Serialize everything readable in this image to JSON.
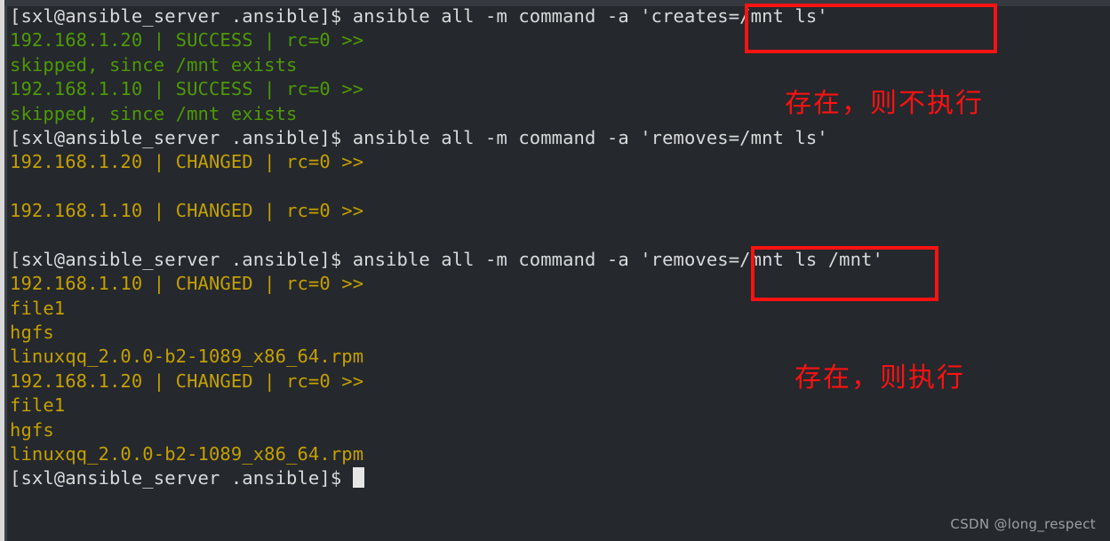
{
  "window": {
    "background_color": "#25282c",
    "top_strip_color": "#343a3f",
    "left_edge_color": "#d9d9d9"
  },
  "colors": {
    "prompt": "#d8dadb",
    "success": "#4e9a06",
    "changed": "#c4a000",
    "annotation_red": "#fb1212",
    "watermark": "#9aa0a6",
    "cursor": "#e6e6e6"
  },
  "terminal": {
    "prompt": "[sxl@ansible_server .ansible]$",
    "lines": [
      {
        "kind": "prompt",
        "prompt": "[sxl@ansible_server .ansible]$",
        "command": " ansible all -m command -a 'creates=/mnt ls'"
      },
      {
        "kind": "success",
        "text": "192.168.1.20 | SUCCESS | rc=0 >>"
      },
      {
        "kind": "success",
        "text": "skipped, since /mnt exists"
      },
      {
        "kind": "success",
        "text": "192.168.1.10 | SUCCESS | rc=0 >>"
      },
      {
        "kind": "success",
        "text": "skipped, since /mnt exists"
      },
      {
        "kind": "prompt",
        "prompt": "[sxl@ansible_server .ansible]$",
        "command": " ansible all -m command -a 'removes=/mnt ls'"
      },
      {
        "kind": "changed",
        "text": "192.168.1.20 | CHANGED | rc=0 >>"
      },
      {
        "kind": "blank",
        "text": ""
      },
      {
        "kind": "changed",
        "text": "192.168.1.10 | CHANGED | rc=0 >>"
      },
      {
        "kind": "blank",
        "text": ""
      },
      {
        "kind": "prompt",
        "prompt": "[sxl@ansible_server .ansible]$",
        "command": " ansible all -m command -a 'removes=/mnt ls /mnt'"
      },
      {
        "kind": "changed",
        "text": "192.168.1.10 | CHANGED | rc=0 >>"
      },
      {
        "kind": "changed",
        "text": "file1"
      },
      {
        "kind": "changed",
        "text": "hgfs"
      },
      {
        "kind": "changed",
        "text": "linuxqq_2.0.0-b2-1089_x86_64.rpm"
      },
      {
        "kind": "changed",
        "text": "192.168.1.20 | CHANGED | rc=0 >>"
      },
      {
        "kind": "changed",
        "text": "file1"
      },
      {
        "kind": "changed",
        "text": "hgfs"
      },
      {
        "kind": "changed",
        "text": "linuxqq_2.0.0-b2-1089_x86_64.rpm"
      },
      {
        "kind": "cursor-prompt",
        "prompt": "[sxl@ansible_server .ansible]$",
        "command": " "
      }
    ]
  },
  "annotations": {
    "box_1_target": "'creates=/mnt ls'",
    "box_2_target": "'removes=/mnt",
    "note_1": "存在，则不执行",
    "note_2": "存在，则执行"
  },
  "watermark": {
    "text": "CSDN @long_respect"
  }
}
